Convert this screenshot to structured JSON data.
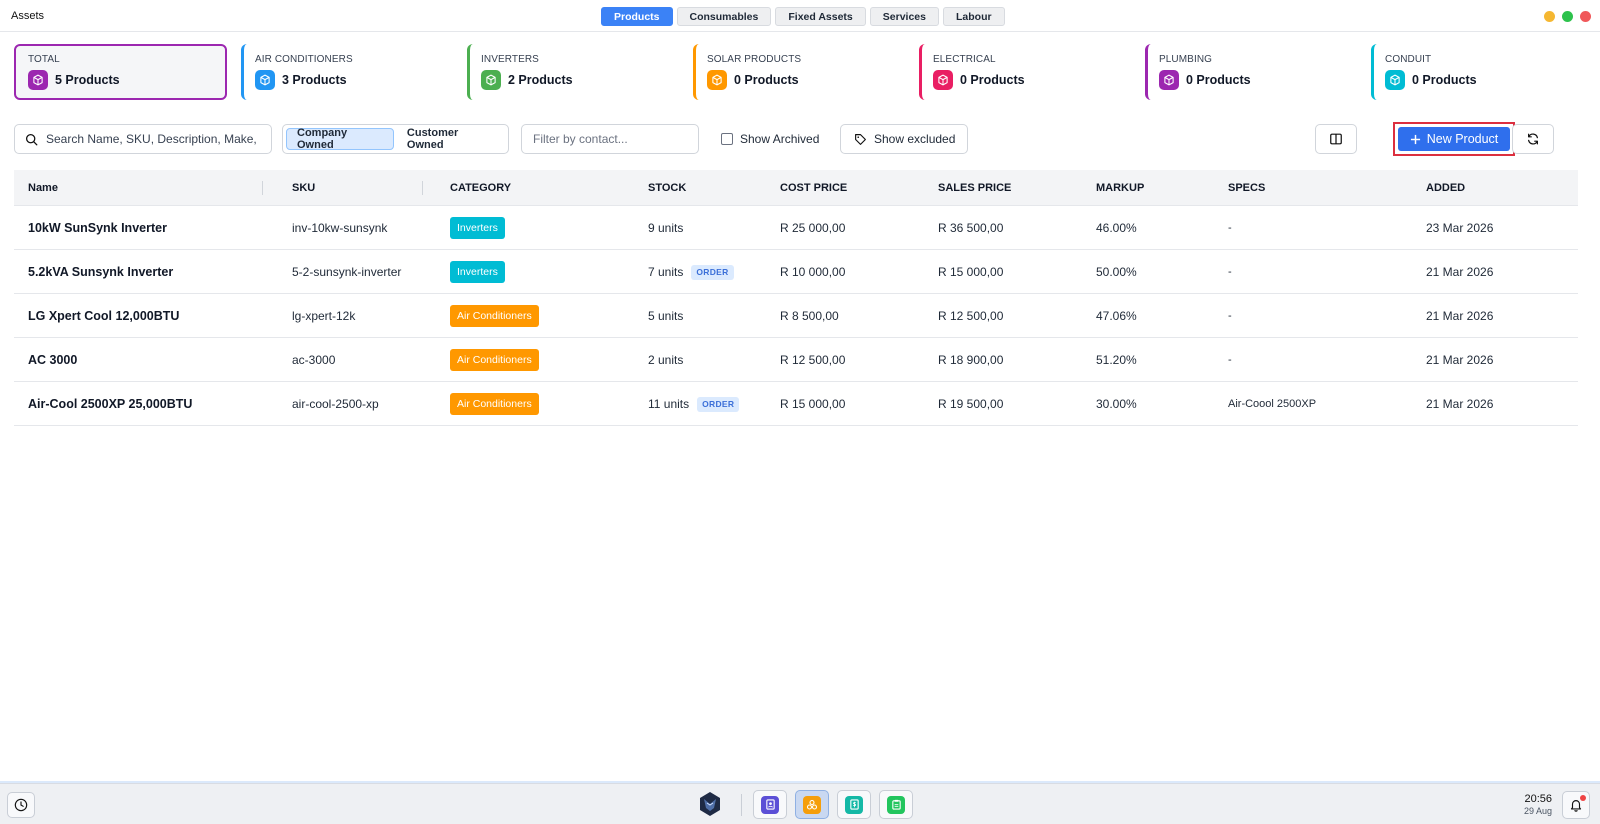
{
  "window": {
    "title": "Assets",
    "controls": [
      {
        "name": "minimize",
        "color": "#f5b731"
      },
      {
        "name": "maximize",
        "color": "#2dc24c"
      },
      {
        "name": "close",
        "color": "#f0585a"
      }
    ]
  },
  "tabs": [
    {
      "label": "Products",
      "active": true
    },
    {
      "label": "Consumables",
      "active": false
    },
    {
      "label": "Fixed Assets",
      "active": false
    },
    {
      "label": "Services",
      "active": false
    },
    {
      "label": "Labour",
      "active": false
    }
  ],
  "cards": [
    {
      "label": "TOTAL",
      "value": "5 Products",
      "color": "#9c27b0",
      "total": true
    },
    {
      "label": "AIR CONDITIONERS",
      "value": "3 Products",
      "color": "#2196f3"
    },
    {
      "label": "INVERTERS",
      "value": "2 Products",
      "color": "#4caf50"
    },
    {
      "label": "SOLAR PRODUCTS",
      "value": "0 Products",
      "color": "#ff9800"
    },
    {
      "label": "ELECTRICAL",
      "value": "0 Products",
      "color": "#e91e63"
    },
    {
      "label": "PLUMBING",
      "value": "0 Products",
      "color": "#9c27b0"
    },
    {
      "label": "CONDUIT",
      "value": "0 Products",
      "color": "#00bcd4"
    }
  ],
  "toolbar": {
    "search_placeholder": "Search Name, SKU, Description, Make,",
    "ownership": [
      {
        "label": "Company Owned",
        "active": true
      },
      {
        "label": "Customer Owned",
        "active": false
      }
    ],
    "contact_placeholder": "Filter by contact...",
    "show_archived_label": "Show Archived",
    "show_excluded_label": "Show excluded",
    "new_product_label": "New Product"
  },
  "table": {
    "headers": [
      "Name",
      "SKU",
      "CATEGORY",
      "STOCK",
      "COST PRICE",
      "SALES PRICE",
      "MARKUP",
      "SPECS",
      "ADDED"
    ],
    "rows": [
      {
        "name": "10kW SunSynk Inverter",
        "sku": "inv-10kw-sunsynk",
        "category": "Inverters",
        "category_color": "#00bcd4",
        "stock": "9 units",
        "order": "",
        "cost": "R 25 000,00",
        "sales": "R 36 500,00",
        "markup": "46.00%",
        "specs": "-",
        "added": "23 Mar 2026"
      },
      {
        "name": "5.2kVA Sunsynk Inverter",
        "sku": "5-2-sunsynk-inverter",
        "category": "Inverters",
        "category_color": "#00bcd4",
        "stock": "7 units",
        "order": "ORDER",
        "cost": "R 10 000,00",
        "sales": "R 15 000,00",
        "markup": "50.00%",
        "specs": "-",
        "added": "21 Mar 2026"
      },
      {
        "name": "LG Xpert Cool 12,000BTU",
        "sku": "lg-xpert-12k",
        "category": "Air Conditioners",
        "category_color": "#ff9800",
        "stock": "5 units",
        "order": "",
        "cost": "R 8 500,00",
        "sales": "R 12 500,00",
        "markup": "47.06%",
        "specs": "-",
        "added": "21 Mar 2026"
      },
      {
        "name": "AC 3000",
        "sku": "ac-3000",
        "category": "Air Conditioners",
        "category_color": "#ff9800",
        "stock": "2 units",
        "order": "",
        "cost": "R 12 500,00",
        "sales": "R 18 900,00",
        "markup": "51.20%",
        "specs": "-",
        "added": "21 Mar 2026"
      },
      {
        "name": "Air-Cool 2500XP 25,000BTU",
        "sku": "air-cool-2500-xp",
        "category": "Air Conditioners",
        "category_color": "#ff9800",
        "stock": "11 units",
        "order": "ORDER",
        "cost": "R 15 000,00",
        "sales": "R 19 500,00",
        "markup": "30.00%",
        "specs": "Air-Coool 2500XP",
        "added": "21 Mar 2026"
      }
    ]
  },
  "taskbar": {
    "time": "20:56",
    "date": "29 Aug",
    "apps": [
      {
        "icon": "contacts-app-icon",
        "color": "#5b4fd6",
        "active": false
      },
      {
        "icon": "assets-app-icon",
        "color": "#f59e0b",
        "active": true
      },
      {
        "icon": "invoice-app-icon",
        "color": "#14b8a6",
        "active": false
      },
      {
        "icon": "clipboard-app-icon",
        "color": "#22c55e",
        "active": false
      }
    ]
  }
}
